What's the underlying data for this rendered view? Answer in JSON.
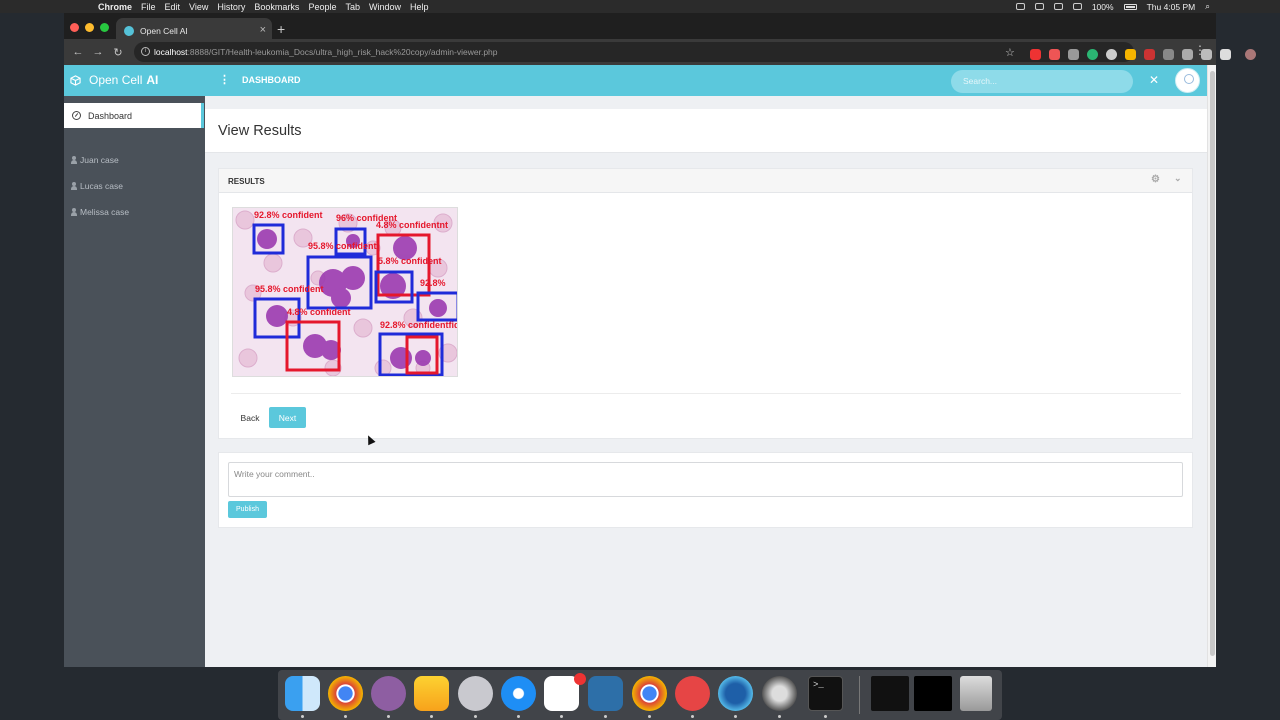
{
  "menubar": {
    "app_name": "Chrome",
    "menus": [
      "File",
      "Edit",
      "View",
      "History",
      "Bookmarks",
      "People",
      "Tab",
      "Window",
      "Help"
    ],
    "battery": "100%",
    "clock": "Thu 4:05 PM"
  },
  "browser": {
    "tab_title": "Open Cell AI",
    "url_host": "localhost",
    "url_path": ":8888/GIT/Health-leukomia_Docs/ultra_high_risk_hack%20copy/admin-viewer.php",
    "tab_close": "×",
    "new_tab": "+"
  },
  "app": {
    "brand_name": "Open Cell",
    "brand_bold": "AI",
    "menu_dots": "⋮",
    "header_title": "DASHBOARD",
    "search_placeholder": "Search...",
    "sidebar": {
      "active": "Dashboard",
      "items": [
        "Juan case",
        "Lucas case",
        "Melissa case"
      ]
    },
    "page_title": "View Results",
    "panel": {
      "title": "RESULTS",
      "back_label": "Back",
      "next_label": "Next"
    },
    "image_labels": {
      "l1": "92.8% confident",
      "l2": "96% confident",
      "l3": "4.8% confidentnt",
      "l4": "95.8% confident",
      "l5": "5.8% confident",
      "l6": "95.8% confident",
      "l7": "92.8%",
      "l8": "4.8% confident",
      "l9": "92.8% confidentfid"
    },
    "comment": {
      "placeholder": "Write your comment..",
      "publish_label": "Publish"
    }
  },
  "colors": {
    "accent": "#5bc8dc",
    "sidebar": "#4a5159",
    "box_blue": "#1f2bd9",
    "box_red": "#e5172c"
  },
  "dock_apps": [
    "Finder",
    "Chrome",
    "GitHub Desktop",
    "Sketch",
    "Sequel Pro",
    "Safari",
    "Slack",
    "Frame app",
    "Chrome",
    "Mail",
    "Edge",
    "DVD Player",
    "Terminal",
    "Trash"
  ]
}
